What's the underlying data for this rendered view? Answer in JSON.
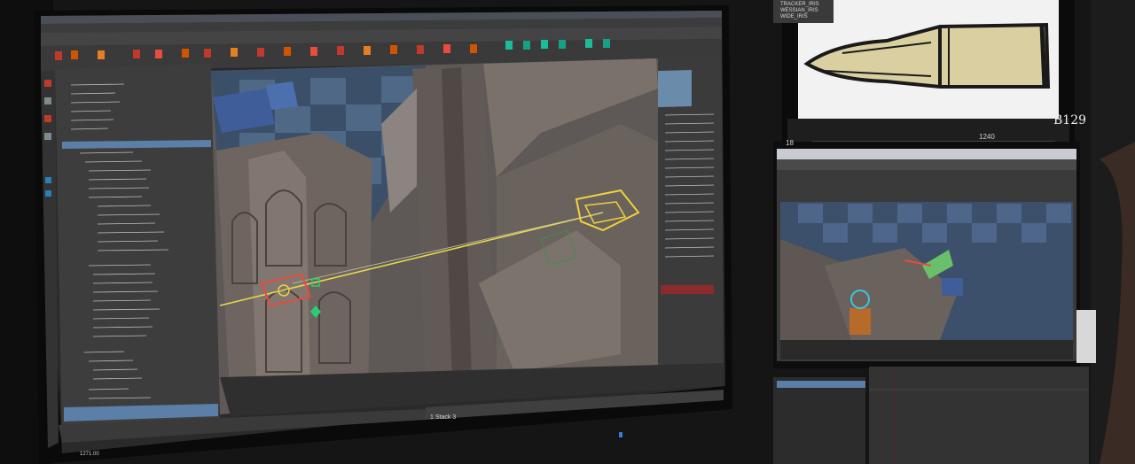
{
  "scene": {
    "description_tag": "photo-of-3d-animation-workstation",
    "storyboard": {
      "panel_code": "B129",
      "frame_counter": "1240",
      "frame_left": "18"
    },
    "maya_status": {
      "text": "1 Stack 3"
    },
    "timeline": {
      "left_readout": "1271.00"
    },
    "side_menu": {
      "items": [
        "TRACKER_IRIS",
        "WESSIAN_IRIS",
        "WIDE_IRIS"
      ]
    }
  }
}
